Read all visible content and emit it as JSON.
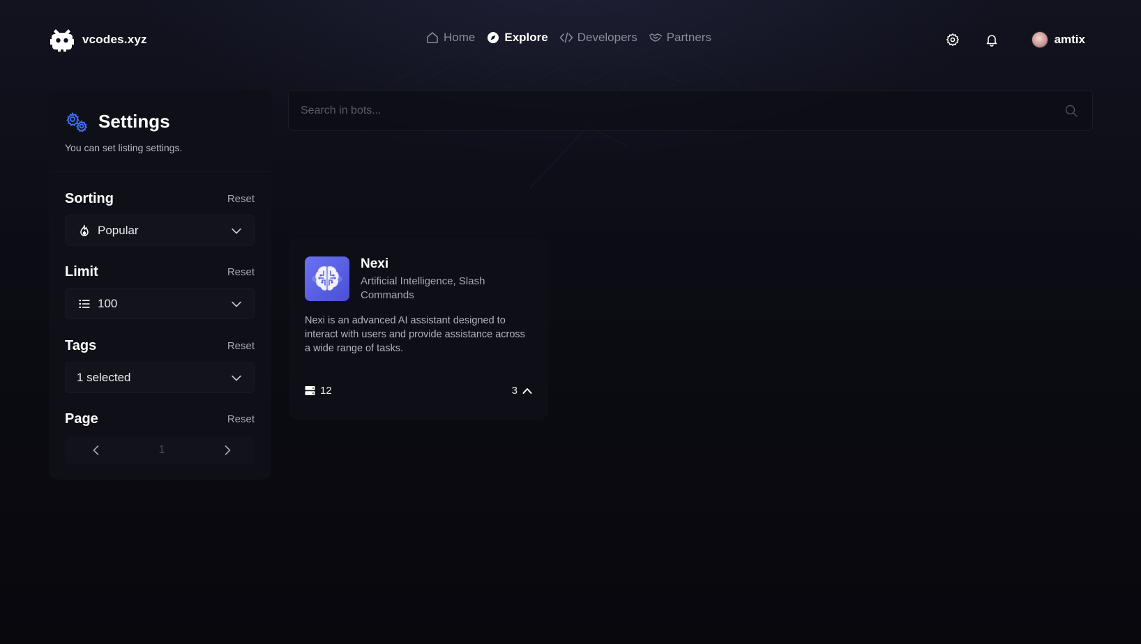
{
  "brand": {
    "name": "vcodes.xyz"
  },
  "nav": {
    "items": [
      {
        "label": "Home",
        "icon": "home-icon",
        "active": false
      },
      {
        "label": "Explore",
        "icon": "compass-icon",
        "active": true
      },
      {
        "label": "Developers",
        "icon": "code-icon",
        "active": false
      },
      {
        "label": "Partners",
        "icon": "handshake-icon",
        "active": false
      }
    ]
  },
  "header": {
    "settings_icon": "gear-icon",
    "notifications_icon": "bell-icon",
    "user": {
      "name": "amtix"
    }
  },
  "sidebar": {
    "title": "Settings",
    "subtitle": "You can set listing settings.",
    "sorting": {
      "label": "Sorting",
      "reset": "Reset",
      "value": "Popular",
      "icon": "flame-icon"
    },
    "limit": {
      "label": "Limit",
      "reset": "Reset",
      "value": "100",
      "icon": "list-icon"
    },
    "tags": {
      "label": "Tags",
      "reset": "Reset",
      "value": "1 selected"
    },
    "page": {
      "label": "Page",
      "reset": "Reset",
      "value": "1"
    }
  },
  "search": {
    "placeholder": "Search in bots..."
  },
  "bots": [
    {
      "name": "Nexi",
      "categories": "Artificial Intelligence, Slash Commands",
      "description": "Nexi is an advanced AI assistant designed to interact with users and provide assistance across a wide range of tasks.",
      "servers": "12",
      "votes": "3",
      "avatar_icon": "brain-icon"
    }
  ],
  "colors": {
    "background": "#0b0b12",
    "panel": "#0f0f17",
    "accent": "#5b63ea",
    "settings_icon_blue": "#3d6ff0"
  }
}
